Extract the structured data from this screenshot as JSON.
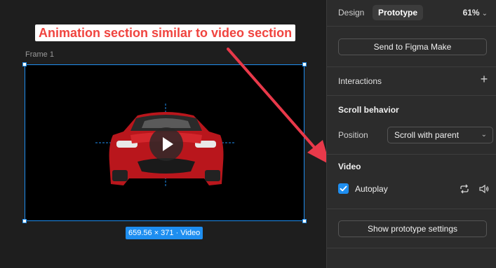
{
  "canvas": {
    "annotation": "Animation section similar to video section",
    "frame_label": "Frame 1",
    "size_tag": "659.56 × 371 · Video"
  },
  "panel": {
    "tabs": [
      {
        "label": "Design",
        "active": false
      },
      {
        "label": "Prototype",
        "active": true
      }
    ],
    "zoom": "61%",
    "send_button": "Send to Figma Make",
    "interactions_title": "Interactions",
    "scroll_title": "Scroll behavior",
    "position_label": "Position",
    "position_value": "Scroll with parent",
    "video_title": "Video",
    "autoplay_label": "Autoplay",
    "autoplay_checked": true,
    "settings_button": "Show prototype settings"
  },
  "colors": {
    "accent": "#1e8ef0",
    "annotation_text": "#f0443f",
    "arrow": "#e8394a"
  },
  "icons": [
    "plus-icon",
    "chevron-down-icon",
    "check-icon",
    "loop-icon",
    "volume-icon",
    "play-icon"
  ]
}
